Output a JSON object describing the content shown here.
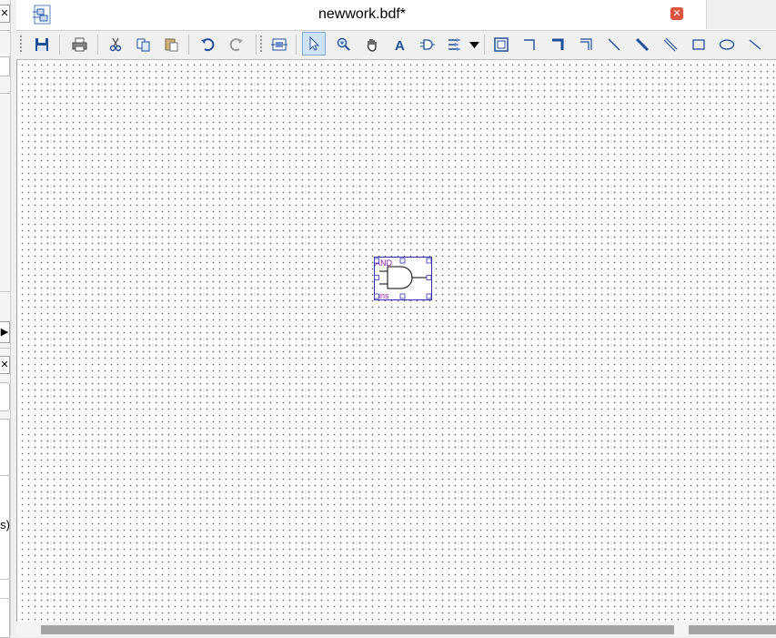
{
  "window": {
    "title": "newwork.bdf*",
    "close_glyph": "✕"
  },
  "left_panel": {
    "close_glyph_top": "✕",
    "arrow_glyph": "▶",
    "close_glyph_mid": "✕",
    "partial_text": "s)"
  },
  "toolbar": {
    "items": [
      "save-icon",
      "print-icon",
      "cut-icon",
      "copy-icon",
      "paste-icon",
      "undo-icon",
      "redo-icon",
      "block-tool-icon",
      "selection-tool-icon",
      "zoom-tool-icon",
      "hand-tool-icon",
      "text-tool-icon",
      "symbol-tool-icon",
      "pin-tool-icon",
      "dropdown-arrow-icon",
      "block-tool-square-icon",
      "orthogonal-node-tool-icon",
      "orthogonal-bus-tool-icon",
      "orthogonal-conduit-tool-icon",
      "node-tool-icon",
      "bus-tool-icon",
      "conduit-tool-icon",
      "rectangle-tool-icon",
      "oval-tool-icon",
      "line-tool-icon"
    ],
    "active_tool": "selection-tool-icon"
  },
  "symbol": {
    "name": "AND2",
    "name_visible": "AND",
    "instance": "inst",
    "instance_visible": "nns",
    "color": "#8a1aa8"
  },
  "colors": {
    "accent_blue": "#1f4e99",
    "close_red": "#e0533e",
    "symbol_border": "#3030b0"
  }
}
